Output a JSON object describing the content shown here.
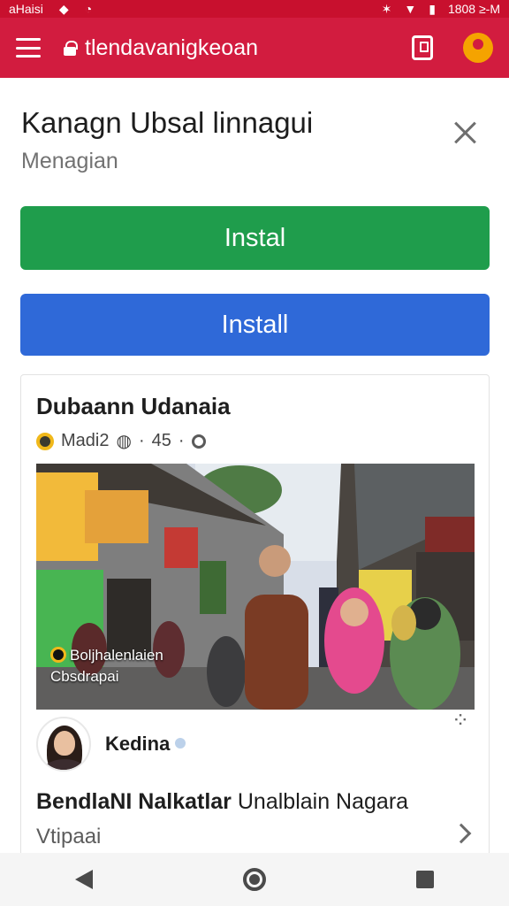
{
  "status_bar": {
    "left_text": "aHaisi",
    "right_text": "1808 ≥-M"
  },
  "browser": {
    "url": "tlendavanigkeoan",
    "icons": {
      "menu": "menu-icon",
      "lock": "lock-icon",
      "tabs": "tabs-icon",
      "account": "account-icon"
    }
  },
  "install_sheet": {
    "title": "Kanagn Ubsal linnagui",
    "subtitle": "Menagian",
    "install_primary": "Instal",
    "install_secondary": "Install"
  },
  "post": {
    "page_name": "Dubaann Udanaia",
    "meta": {
      "label": "Madi2",
      "time": "45"
    },
    "photo_caption_line1": "Boljhalenlaien",
    "photo_caption_line2": "Cbsdrapai",
    "author": {
      "name": "Kedina"
    },
    "headline_bold": "BendlaNI Nalkatlar",
    "headline_rest": "Unalblain Nagara",
    "source": "Vtipaai"
  },
  "colors": {
    "status_bar": "#c8102e",
    "app_bar": "#d21c3f",
    "install_green": "#1f9d4c",
    "install_blue": "#2f69d8",
    "nav_bar": "#f5f5f5"
  }
}
